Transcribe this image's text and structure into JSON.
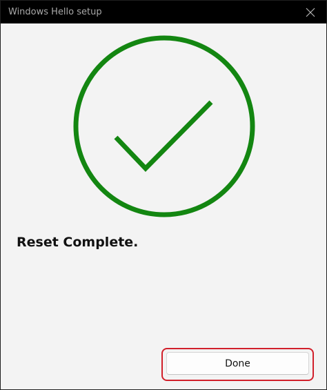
{
  "window": {
    "title": "Windows Hello setup"
  },
  "icons": {
    "close": "close-icon",
    "status": "checkmark-circle-icon"
  },
  "main": {
    "message": "Reset Complete.",
    "done_label": "Done"
  },
  "colors": {
    "success": "#138611",
    "highlight": "#d11f2a",
    "titlebar": "#000000"
  }
}
